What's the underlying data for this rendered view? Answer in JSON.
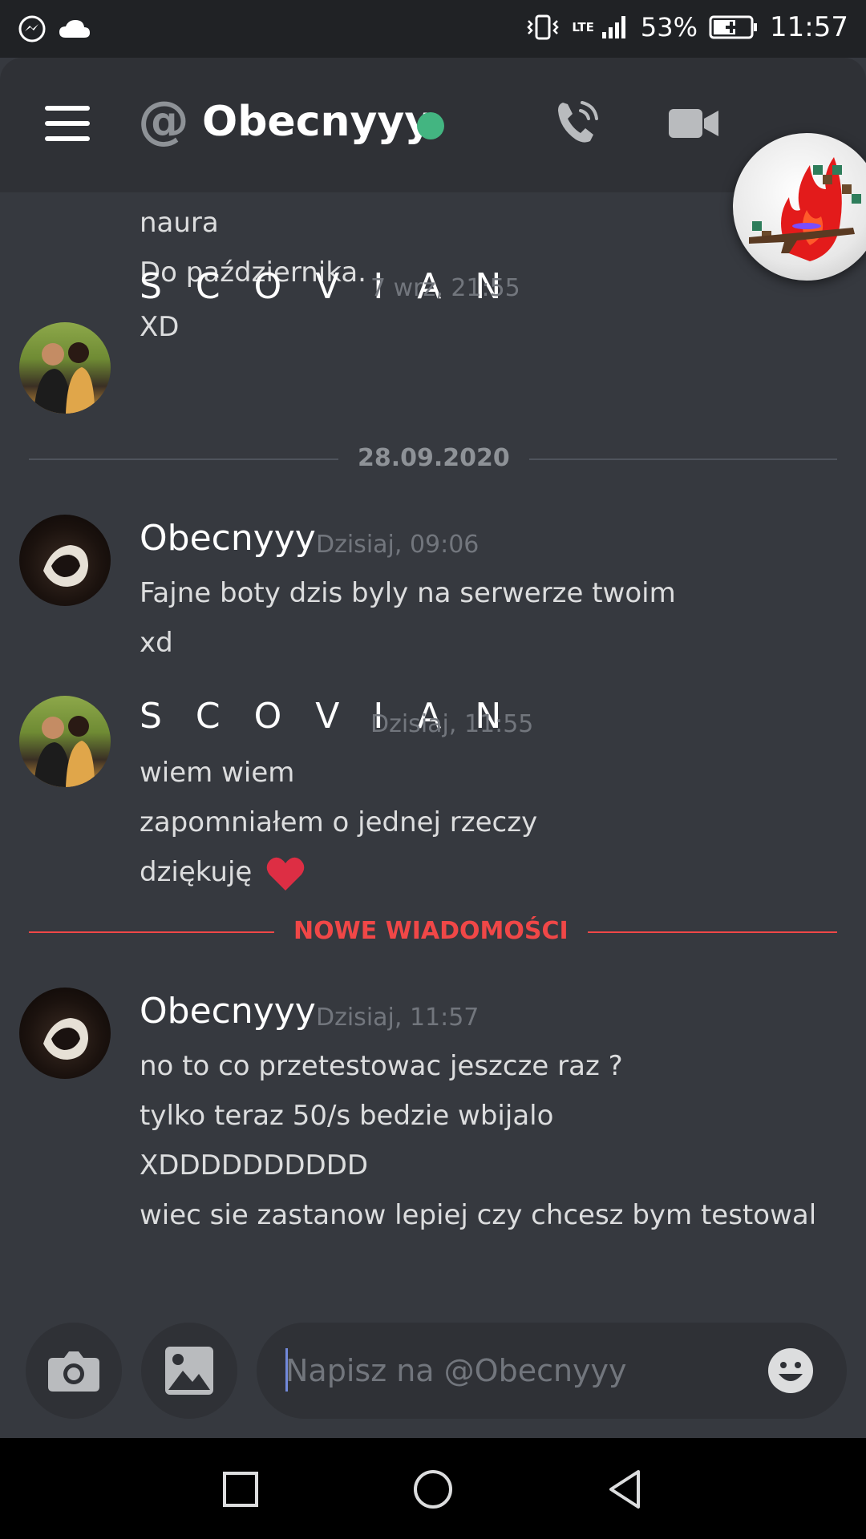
{
  "status_bar": {
    "icons": [
      "messenger-icon",
      "cloud-icon",
      "vibrate-icon",
      "signal-icon",
      "battery-charging-icon"
    ],
    "network": "LTE",
    "battery": "53%",
    "time": "11:57"
  },
  "header": {
    "channel_prefix_icon": "at-icon",
    "title": "Obecnyyy",
    "status": "online",
    "status_color": "#43b581",
    "actions": [
      "call-icon",
      "video-call-icon"
    ]
  },
  "messages": {
    "continued_lines": [
      "naura",
      "Do października."
    ],
    "groups": [
      {
        "author": "S C O V I A N",
        "timestamp": "7 wrz, 21:55",
        "lines": [
          "XD"
        ]
      },
      {
        "author": "Obecnyyy",
        "timestamp": "Dzisiaj, 09:06",
        "lines": [
          "Fajne boty dzis byly na serwerze twoim",
          "xd"
        ]
      },
      {
        "author": "S C O V I A N",
        "timestamp": "Dzisiaj, 11:55",
        "lines": [
          "wiem wiem",
          "zapomniałem o jednej rzeczy",
          "dziękuję"
        ]
      },
      {
        "author": "Obecnyyy",
        "timestamp": "Dzisiaj, 11:57",
        "lines": [
          "no to co przetestowac jeszcze raz ?",
          "tylko teraz 50/s bedzie wbijalo",
          "XDDDDDDDDDD",
          "wiec sie zastanow lepiej czy chcesz bym testowal"
        ]
      }
    ],
    "date_divider": "28.09.2020",
    "new_messages_divider": "NOWE WIADOMOŚCI",
    "accent_red": "#f04747"
  },
  "composer": {
    "placeholder": "Napisz na @Obecnyyy",
    "buttons": [
      "camera-icon",
      "image-icon",
      "emoji-icon"
    ]
  },
  "nav_bar": {
    "buttons": [
      "recent-apps-icon",
      "home-icon",
      "back-icon"
    ]
  }
}
